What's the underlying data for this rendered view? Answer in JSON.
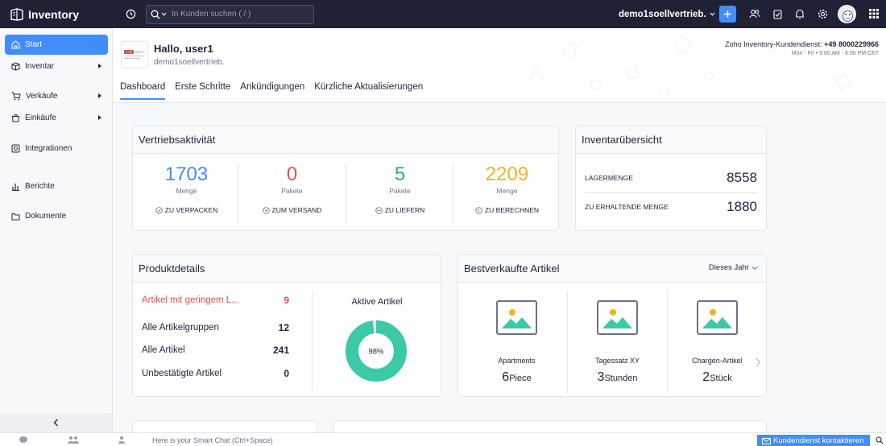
{
  "app": {
    "name": "Inventory"
  },
  "topbar": {
    "search_placeholder": "In Kunden suchen ( / )",
    "org_name": "demo1soellvertrieb."
  },
  "sidebar": {
    "items": [
      {
        "label": "Start",
        "icon": "home-icon",
        "active": true,
        "has_submenu": false
      },
      {
        "label": "Inventar",
        "icon": "box-icon",
        "has_submenu": true
      },
      {
        "label": "Verkäufe",
        "icon": "cart-icon",
        "has_submenu": true
      },
      {
        "label": "Einkäufe",
        "icon": "bag-icon",
        "has_submenu": true
      },
      {
        "label": "Integrationen",
        "icon": "integrations-icon",
        "has_submenu": false
      },
      {
        "label": "Berichte",
        "icon": "reports-icon",
        "has_submenu": false
      },
      {
        "label": "Dokumente",
        "icon": "folder-icon",
        "has_submenu": false
      }
    ]
  },
  "header": {
    "greeting": "Hallo, user1",
    "org": "demo1soellvertrieb.",
    "support_label": "Zoho Inventory-Kundendienst:",
    "support_phone": "+49 8000229966",
    "support_hours": "Mon - Fri • 9:00 AM - 6:00 PM CET",
    "tabs": [
      {
        "label": "Dashboard",
        "active": true
      },
      {
        "label": "Erste Schritte"
      },
      {
        "label": "Ankündigungen"
      },
      {
        "label": "Kürzliche Aktualisierungen"
      }
    ]
  },
  "sales_activity": {
    "title": "Vertriebsaktivität",
    "items": [
      {
        "value": "1703",
        "unit": "Menge",
        "status": "ZU VERPACKEN",
        "color": "#408dfb"
      },
      {
        "value": "0",
        "unit": "Pakete",
        "status": "ZUM VERSAND",
        "color": "#e94d56"
      },
      {
        "value": "5",
        "unit": "Pakete",
        "status": "ZU LIEFERN",
        "color": "#21b573"
      },
      {
        "value": "2209",
        "unit": "Menge",
        "status": "ZU BERECHNEN",
        "color": "#f0b323"
      }
    ]
  },
  "inventory_summary": {
    "title": "Inventarübersicht",
    "rows": [
      {
        "label": "LAGERMENGE",
        "value": "8558"
      },
      {
        "label": "ZU ERHALTENDE MENGE",
        "value": "1880"
      }
    ]
  },
  "product_details": {
    "title": "Produktdetails",
    "rows": [
      {
        "label": "Artikel mit geringem L...",
        "value": "9",
        "warn": true
      },
      {
        "label": "Alle Artikelgruppen",
        "value": "12"
      },
      {
        "label": "Alle Artikel",
        "value": "241"
      },
      {
        "label": "Unbestätigte Artikel",
        "value": "0"
      }
    ],
    "active_items_title": "Aktive Artikel",
    "active_percent": 98,
    "active_percent_label": "98%"
  },
  "top_selling": {
    "title": "Bestverkaufte Artikel",
    "period": "Dieses Jahr",
    "items": [
      {
        "name": "Apartments",
        "qty": "6",
        "unit": "Piece"
      },
      {
        "name": "Tagessatz XY",
        "qty": "3",
        "unit": "Stunden"
      },
      {
        "name": "Chargen-Artikel",
        "qty": "2",
        "unit": "Stück"
      }
    ]
  },
  "footer": {
    "chat_placeholder": "Here is your Smart Chat (Ctrl+Space)",
    "contact_label": "Kundendienst kontaktieren"
  },
  "colors": {
    "accent": "#408dfb",
    "topbar": "#1f2235",
    "donut": "#3cc9a8",
    "warn": "#e94d56"
  }
}
